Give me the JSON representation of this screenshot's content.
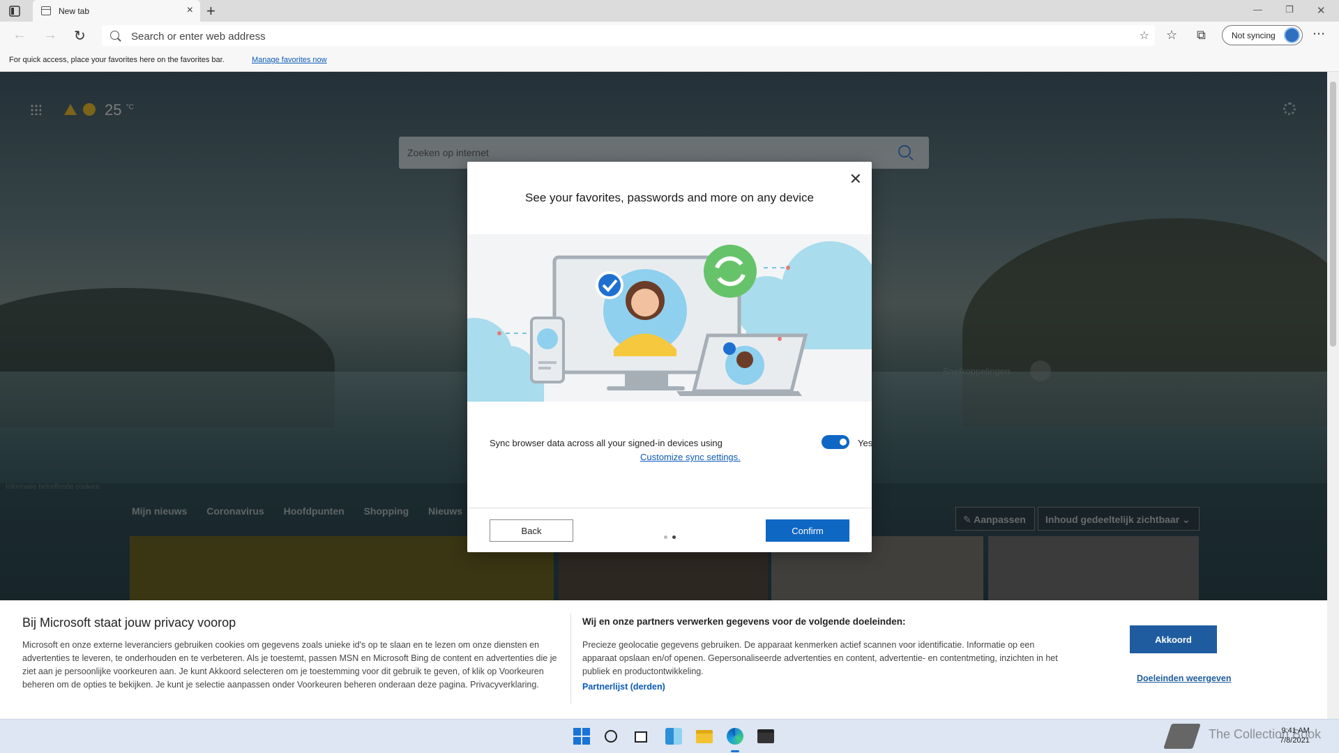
{
  "browser": {
    "tab_title": "New tab",
    "address_placeholder": "Search or enter web address",
    "sync_label": "Not syncing",
    "favorites_message": "For quick access, place your favorites here on the favorites bar.",
    "favorites_link": "Manage favorites now"
  },
  "ntp": {
    "temperature": "25",
    "temperature_unit": "°C",
    "search_placeholder": "Zoeken op internet",
    "quick_links": "Snelkoppelingen",
    "cookie_info": "Informatie betreffende cookies",
    "news_tabs": [
      "Mijn nieuws",
      "Coronavirus",
      "Hoofdpunten",
      "Shopping",
      "Nieuws"
    ],
    "customize_label": "Aanpassen",
    "content_visibility": "Inhoud gedeeltelijk zichtbaar"
  },
  "modal": {
    "heading": "See your favorites, passwords and more on any device",
    "sync_description": "Sync browser data across all your signed-in devices using",
    "sync_link": "Customize sync settings.",
    "toggle_state": "Yes",
    "back_label": "Back",
    "confirm_label": "Confirm",
    "pages_total": 2,
    "page_current": 2
  },
  "privacy": {
    "title": "Bij Microsoft staat jouw privacy voorop",
    "body": "Microsoft en onze externe leveranciers gebruiken cookies om gegevens zoals unieke id's op te slaan en te lezen om onze diensten en advertenties te leveren, te onderhouden en te verbeteren. Als je toestemt, passen MSN en Microsoft Bing de content en advertenties die je ziet aan je persoonlijke voorkeuren aan. Je kunt Akkoord selecteren om je toestemming voor dit gebruik te geven, of klik op Voorkeuren beheren om de opties te bekijken. Je kunt je selectie aanpassen onder Voorkeuren beheren onderaan deze pagina. Privacyverklaring.",
    "purposes_title": "Wij en onze partners verwerken gegevens voor de volgende doeleinden:",
    "purposes_body": "Precieze geolocatie gegevens gebruiken. De apparaat kenmerken actief scannen voor identificatie. Informatie op een apparaat opslaan en/of openen. Gepersonaliseerde advertenties en content, advertentie- en contentmeting, inzichten in het publiek en productontwikkeling.",
    "partners_link": "Partnerlijst (derden)",
    "accept_label": "Akkoord",
    "purposes_link": "Doeleinden weergeven"
  },
  "taskbar": {
    "watermark": "The Collection Book",
    "time": "9:41 AM",
    "date": "7/8/2021"
  },
  "colors": {
    "accent": "#0f67c4",
    "privacy_accent": "#1f5c9f",
    "link": "#0b5ab6"
  }
}
